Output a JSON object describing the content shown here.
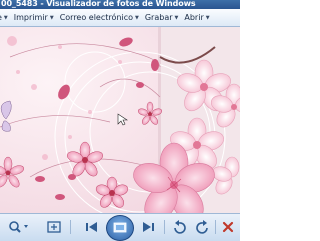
{
  "window": {
    "title": "00_5483 - Visualizador de fotos de Windows"
  },
  "menu": {
    "items": [
      {
        "label": "e"
      },
      {
        "label": "Imprimir"
      },
      {
        "label": "Correo electrónico"
      },
      {
        "label": "Grabar"
      },
      {
        "label": "Abrir"
      }
    ]
  },
  "toolbar": {
    "buttons": [
      {
        "icon": "zoom-icon"
      },
      {
        "icon": "fit-window-icon"
      },
      {
        "icon": "previous-icon"
      },
      {
        "icon": "slideshow-icon"
      },
      {
        "icon": "next-icon"
      },
      {
        "icon": "rotate-left-icon"
      },
      {
        "icon": "rotate-right-icon"
      },
      {
        "icon": "delete-icon"
      }
    ]
  },
  "colors": {
    "accent": "#2f5d93",
    "delete": "#c0392b",
    "blossom": "#f2a7bf",
    "blossom_dark": "#c24a6e"
  }
}
